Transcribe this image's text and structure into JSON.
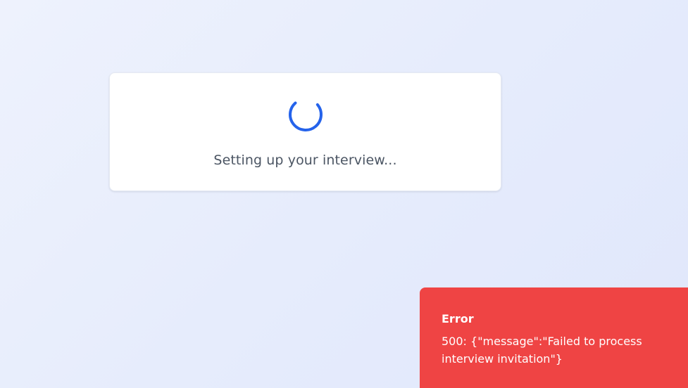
{
  "loading": {
    "message": "Setting up your interview...",
    "spinner_icon": "spinner-icon",
    "spinner_color": "#2563eb"
  },
  "toast": {
    "title": "Error",
    "message": "500: {\"message\":\"Failed to process interview invitation\"}",
    "background_color": "#ef4444"
  }
}
